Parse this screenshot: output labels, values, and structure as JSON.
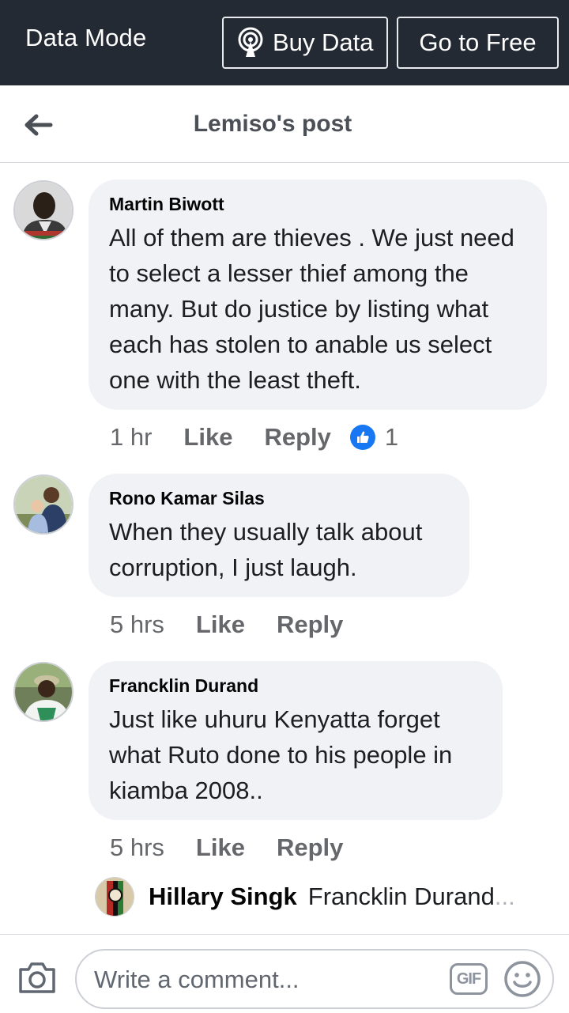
{
  "databar": {
    "mode_label": "Data Mode",
    "buy_label": "Buy Data",
    "free_label": "Go to Free"
  },
  "header": {
    "title": "Lemiso's post"
  },
  "comments": [
    {
      "name": "Martin Biwott",
      "text": "All of them are thieves . We just need to select a lesser thief among the many. But do justice by listing what each has stolen to anable us select one with the least theft.",
      "time": "1 hr",
      "like": "Like",
      "reply": "Reply",
      "reaction_count": "1"
    },
    {
      "name": "Rono Kamar Silas",
      "text": "When they usually talk about corruption, I just laugh.",
      "time": "5 hrs",
      "like": "Like",
      "reply": "Reply"
    },
    {
      "name": "Francklin Durand",
      "text": "Just like uhuru Kenyatta forget what Ruto done to his people in kiamba 2008..",
      "time": "5 hrs",
      "like": "Like",
      "reply": "Reply"
    }
  ],
  "reply_preview": {
    "name": "Hillary Singk",
    "text": "Francklin Durand",
    "ellipsis": "..."
  },
  "composer": {
    "placeholder": "Write a comment...",
    "gif_label": "GIF"
  },
  "colors": {
    "databar_bg": "#232a33",
    "bubble_bg": "#f0f2f5",
    "like_blue": "#1877f2",
    "meta_gray": "#65676b"
  }
}
